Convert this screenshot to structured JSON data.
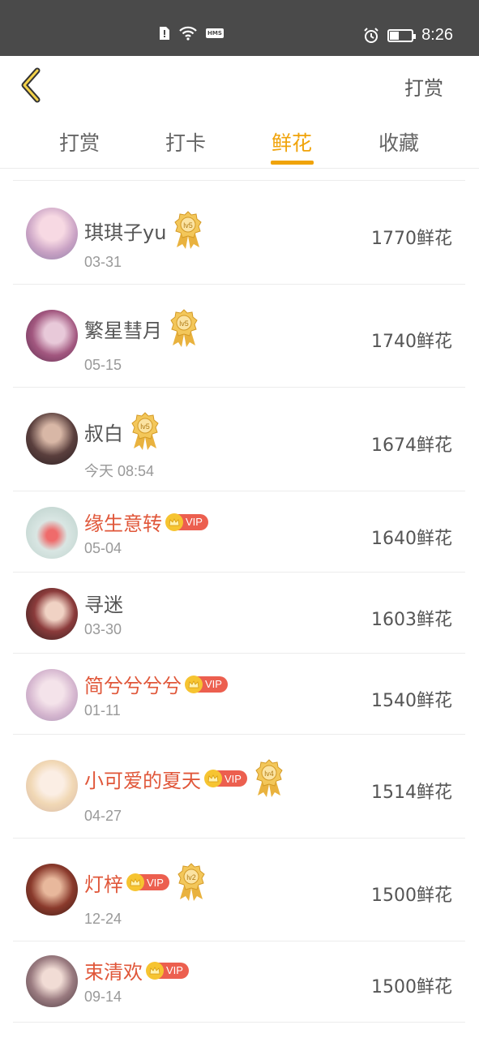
{
  "status_bar": {
    "time": "8:26",
    "hms_label": "HMS"
  },
  "header": {
    "right_label": "打赏"
  },
  "tabs": [
    {
      "label": "打赏"
    },
    {
      "label": "打卡"
    },
    {
      "label": "鲜花",
      "active": true
    },
    {
      "label": "收藏"
    }
  ],
  "vip_label": "VIP",
  "rows": [
    {
      "name": "琪琪子yu",
      "date": "03-31",
      "amount": "1770鲜花",
      "vip": false,
      "level": "lv5"
    },
    {
      "name": "繁星彗月",
      "date": "05-15",
      "amount": "1740鲜花",
      "vip": false,
      "level": "lv5"
    },
    {
      "name": "叔白",
      "date": "今天 08:54",
      "amount": "1674鲜花",
      "vip": false,
      "level": "lv5"
    },
    {
      "name": "缘生意转",
      "date": "05-04",
      "amount": "1640鲜花",
      "vip": true,
      "level": ""
    },
    {
      "name": "寻迷",
      "date": "03-30",
      "amount": "1603鲜花",
      "vip": false,
      "level": ""
    },
    {
      "name": "简兮兮兮兮",
      "date": "01-11",
      "amount": "1540鲜花",
      "vip": true,
      "level": ""
    },
    {
      "name": "小可爱的夏天",
      "date": "04-27",
      "amount": "1514鲜花",
      "vip": true,
      "level": "lv4"
    },
    {
      "name": "灯梓",
      "date": "12-24",
      "amount": "1500鲜花",
      "vip": true,
      "level": "lv2"
    },
    {
      "name": "束清欢",
      "date": "09-14",
      "amount": "1500鲜花",
      "vip": true,
      "level": ""
    }
  ]
}
